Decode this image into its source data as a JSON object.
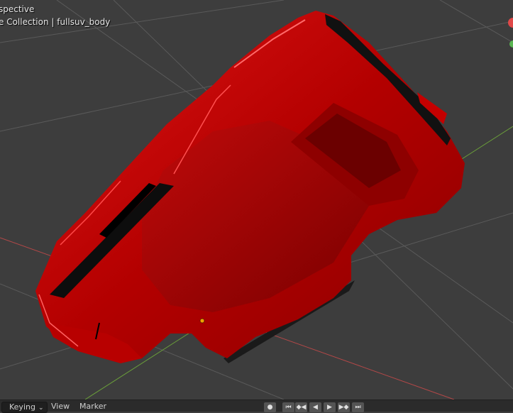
{
  "viewport": {
    "view_name": "spective",
    "collection_label": "e Collection | fullsuv_body",
    "object": "fullsuv_body",
    "background_color": "#3d3d3d",
    "body_color": "#c20000",
    "x_axis_color": "#b34848",
    "y_axis_color": "#6a9e3a",
    "gizmo": {
      "x_color": "#e04848",
      "y_color": "#5ab552"
    }
  },
  "timeline": {
    "keying_label": "Keying",
    "menu_view": "View",
    "menu_marker": "Marker",
    "buttons": [
      {
        "icon": "record-icon",
        "glyph": "●"
      },
      {
        "icon": "jump-start-icon",
        "glyph": "⏮"
      },
      {
        "icon": "prev-keyframe-icon",
        "glyph": "◆◀"
      },
      {
        "icon": "play-reverse-icon",
        "glyph": "◀"
      },
      {
        "icon": "play-icon",
        "glyph": "▶"
      },
      {
        "icon": "next-keyframe-icon",
        "glyph": "▶◆"
      },
      {
        "icon": "jump-end-icon",
        "glyph": "⏭"
      }
    ]
  }
}
